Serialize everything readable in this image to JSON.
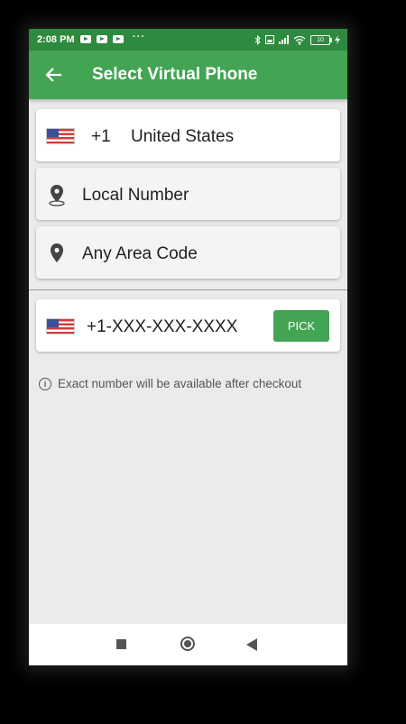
{
  "status_bar": {
    "time": "2:08 PM",
    "dots": "···",
    "battery": "10"
  },
  "app_bar": {
    "title": "Select Virtual Phone"
  },
  "country_row": {
    "code": "+1",
    "name": "United States"
  },
  "number_type": {
    "label": "Local Number"
  },
  "area_code": {
    "label": "Any Area Code"
  },
  "number_row": {
    "number": "+1-XXX-XXX-XXXX",
    "pick_label": "PICK"
  },
  "info": {
    "text": "Exact number will be available after checkout"
  },
  "colors": {
    "status_bar": "#2e8a3e",
    "app_bar": "#43a453",
    "background": "#ebebeb",
    "button": "#43a453"
  }
}
